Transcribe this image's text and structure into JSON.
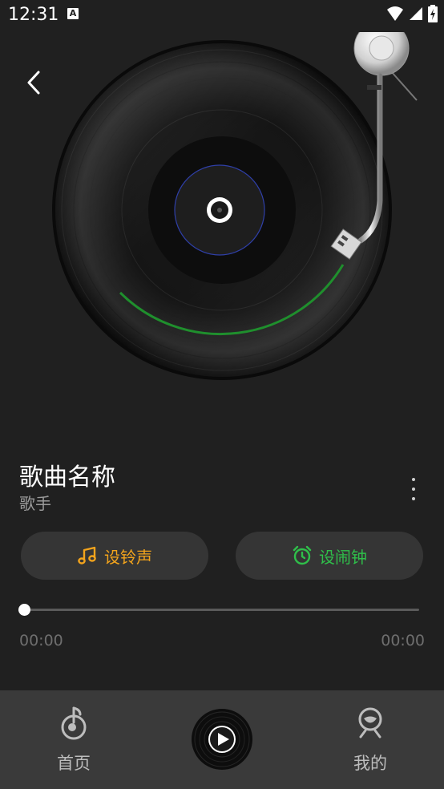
{
  "status_bar": {
    "time": "12:31",
    "notification_icon": "A",
    "icons": [
      "wifi-icon",
      "signal-icon",
      "battery-charging-icon"
    ]
  },
  "player": {
    "song_title": "歌曲名称",
    "artist": "歌手",
    "ringtone_label": "设铃声",
    "alarm_label": "设闹钟",
    "time_current": "00:00",
    "time_total": "00:00",
    "progress": 0
  },
  "bottom_nav": {
    "home_label": "首页",
    "mine_label": "我的"
  },
  "colors": {
    "ringtone": "#f3a41c",
    "alarm": "#2fbf4a",
    "background": "#202020",
    "nav_background": "#3a3a3a"
  }
}
